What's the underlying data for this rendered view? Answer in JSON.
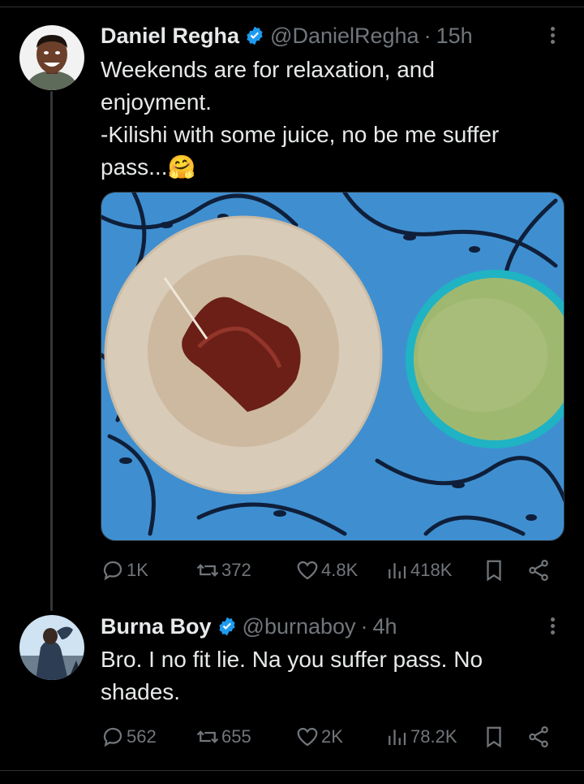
{
  "tweets": [
    {
      "name": "Daniel Regha",
      "handle": "@DanielRegha",
      "dot": "·",
      "time": "15h",
      "lines": [
        "Weekends are for relaxation, and",
        "enjoyment.",
        "-Kilishi with some juice, no be me suffer",
        "pass...🤗"
      ],
      "stats": {
        "replies": "1K",
        "reposts": "372",
        "likes": "4.8K",
        "views": "418K"
      }
    },
    {
      "name": "Burna Boy",
      "handle": "@burnaboy",
      "dot": "·",
      "time": "4h",
      "lines": [
        "Bro. I no fit lie. Na you suffer pass. No",
        "shades."
      ],
      "stats": {
        "replies": "562",
        "reposts": "655",
        "likes": "2K",
        "views": "78.2K"
      }
    }
  ],
  "icons": {
    "reply": "reply-icon",
    "repost": "repost-icon",
    "like": "heart-icon",
    "views": "views-icon",
    "bookmark": "bookmark-icon",
    "share": "share-icon",
    "verified": "verified-badge-icon",
    "more": "more-options-icon"
  },
  "colors": {
    "background": "#000000",
    "text": "#e7e9ea",
    "muted": "#71767b",
    "verified": "#1d9bf0",
    "divider": "#2f3336"
  }
}
